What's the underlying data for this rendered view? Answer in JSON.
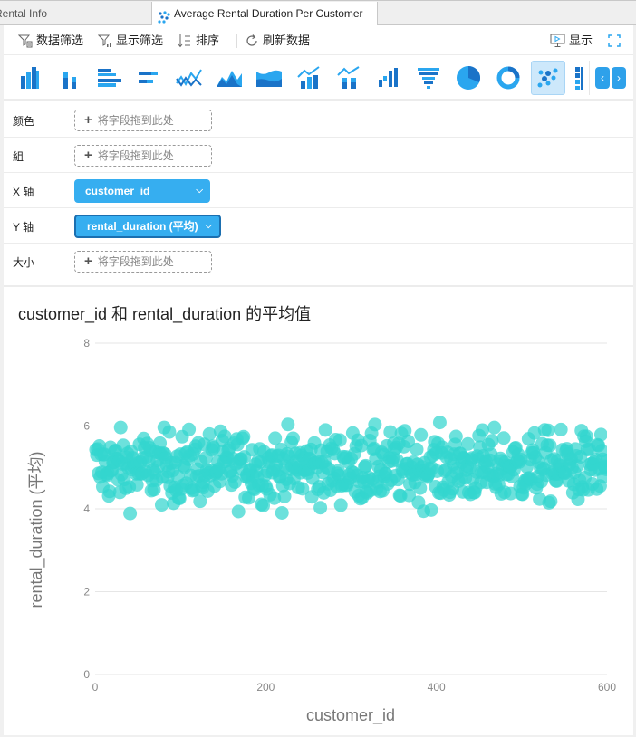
{
  "tabs": [
    {
      "label": "Rental Info",
      "active": false
    },
    {
      "label": "Average Rental Duration Per Customer",
      "active": true,
      "icon": "scatter-chart-icon"
    }
  ],
  "toolbar": {
    "data_filter": "数据筛选",
    "display_filter": "显示筛选",
    "sort": "排序",
    "refresh": "刷新数据",
    "show": "显示"
  },
  "chart_types": [
    {
      "name": "clustered-column",
      "active": false
    },
    {
      "name": "stacked-column",
      "active": false
    },
    {
      "name": "clustered-bar",
      "active": false
    },
    {
      "name": "stacked-bar",
      "active": false
    },
    {
      "name": "line",
      "active": false
    },
    {
      "name": "area",
      "active": false
    },
    {
      "name": "stacked-area",
      "active": false
    },
    {
      "name": "line-column-combo",
      "active": false
    },
    {
      "name": "line-stacked-column-combo",
      "active": false
    },
    {
      "name": "waterfall",
      "active": false
    },
    {
      "name": "funnel",
      "active": false
    },
    {
      "name": "pie",
      "active": false
    },
    {
      "name": "donut",
      "active": false
    },
    {
      "name": "scatter",
      "active": true
    },
    {
      "name": "table",
      "active": false
    }
  ],
  "fields": {
    "color": {
      "label": "颜色",
      "placeholder": "将字段拖到此处"
    },
    "group": {
      "label": "組",
      "placeholder": "将字段拖到此处"
    },
    "x_axis": {
      "label": "X 轴",
      "value": "customer_id"
    },
    "y_axis": {
      "label": "Y 轴",
      "value": "rental_duration (平均)"
    },
    "size": {
      "label": "大小",
      "placeholder": "将字段拖到此处"
    }
  },
  "chart_data": {
    "type": "scatter",
    "title": "customer_id 和 rental_duration 的平均值",
    "xlabel": "customer_id",
    "ylabel": "rental_duration (平均)",
    "xlim": [
      0,
      600
    ],
    "ylim": [
      0,
      8
    ],
    "xticks": [
      0,
      200,
      400,
      600
    ],
    "yticks": [
      0,
      2,
      4,
      6,
      8
    ],
    "grid": true,
    "point_color": "#33d6cf",
    "n_points": 600,
    "x_range": [
      1,
      600
    ],
    "y_mean": 5.0,
    "y_min": 3.5,
    "y_max": 6.5,
    "note": "one point per customer_id 1..600; average rental_duration values clustered around ~5 with range ~3.5–6.5"
  }
}
